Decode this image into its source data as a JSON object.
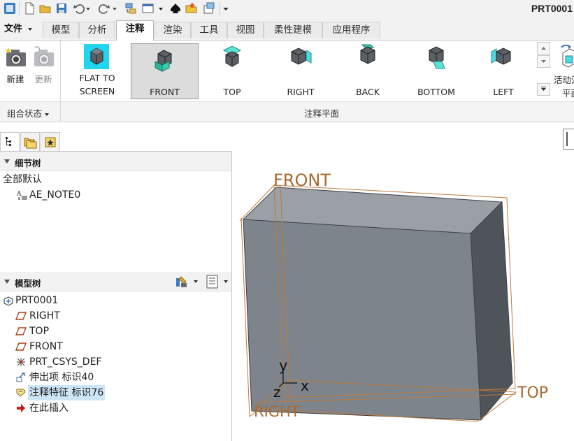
{
  "window": {
    "title": "PRT0001"
  },
  "quick_access": {
    "icons": [
      "app-icon",
      "new-icon",
      "open-icon",
      "save-icon",
      "undo-icon",
      "dropdown-icon",
      "redo-icon",
      "dropdown-icon",
      "regenerate-icon",
      "windows-icon",
      "dropdown-icon",
      "spade-icon",
      "folder-icon",
      "close-window-icon",
      "customize-icon"
    ]
  },
  "tabs": {
    "file": "文件",
    "items": [
      {
        "label": "模型"
      },
      {
        "label": "分析"
      },
      {
        "label": "注释"
      },
      {
        "label": "渲染"
      },
      {
        "label": "工具"
      },
      {
        "label": "视图"
      },
      {
        "label": "柔性建模"
      },
      {
        "label": "应用程序"
      }
    ],
    "active": "注释"
  },
  "ribbon": {
    "combined_state": {
      "new_label": "新建",
      "update_label": "更新",
      "group_label": "组合状态"
    },
    "annotation_planes": {
      "group_label": "注释平面",
      "buttons": [
        {
          "label_line1": "FLAT  TO",
          "label_line2": "SCREEN"
        },
        {
          "label_line1": "FRONT",
          "label_line2": ""
        },
        {
          "label_line1": "TOP",
          "label_line2": ""
        },
        {
          "label_line1": "RIGHT",
          "label_line2": ""
        },
        {
          "label_line1": "BACK",
          "label_line2": ""
        },
        {
          "label_line1": "BOTTOM",
          "label_line2": ""
        },
        {
          "label_line1": "LEFT",
          "label_line2": ""
        }
      ],
      "selected": "FRONT"
    },
    "active_plane": {
      "label_line1": "活动注",
      "label_line2": "平面"
    }
  },
  "detail_tree": {
    "title": "细节树",
    "items": [
      {
        "label": "全部默认",
        "icon": "none"
      },
      {
        "label": "AE_NOTE0",
        "icon": "annotation-icon"
      }
    ]
  },
  "model_tree": {
    "title": "模型树",
    "items": [
      {
        "label": "PRT0001",
        "icon": "part-icon"
      },
      {
        "label": "RIGHT",
        "icon": "datum-plane-icon"
      },
      {
        "label": "TOP",
        "icon": "datum-plane-icon"
      },
      {
        "label": "FRONT",
        "icon": "datum-plane-icon"
      },
      {
        "label": "PRT_CSYS_DEF",
        "icon": "csys-icon"
      },
      {
        "label": "伸出项 标识40",
        "icon": "extrude-icon"
      },
      {
        "label": "注释特征 标识76",
        "icon": "annotation-feature-icon"
      },
      {
        "label": "在此插入",
        "icon": "insert-here-icon"
      }
    ],
    "highlighted": "注释特征 标识76"
  },
  "graphics": {
    "plane_labels": {
      "front": "FRONT",
      "top": "TOP",
      "right": "RIGHT"
    },
    "axis_labels": {
      "x": "x",
      "y": "y",
      "z": "z"
    },
    "colors": {
      "datum": "#b5733a",
      "face_front": "#7d848b",
      "face_top": "#9aa0a6",
      "face_side": "#50545a"
    }
  }
}
